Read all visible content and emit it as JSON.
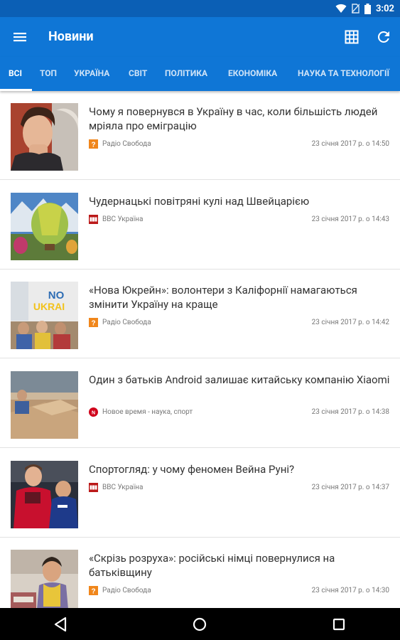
{
  "status": {
    "time": "3:02"
  },
  "app": {
    "title": "Новини"
  },
  "tabs": [
    "ВСІ",
    "ТОП",
    "УКРАЇНА",
    "СВІТ",
    "ПОЛІТИКА",
    "ЕКОНОМІКА",
    "НАУКА ТА ТЕХНОЛОГІЇ"
  ],
  "articles": [
    {
      "title": "Чому я повернувся в Україну в час, коли більшість людей мріяла про еміграцію",
      "source": "Радіо Свобода",
      "date": "23 січня 2017 р. о 14:50"
    },
    {
      "title": "Чудернацькі повітряні кулі над Швейцарією",
      "source": "BBC Україна",
      "date": "23 січня 2017 р. о 14:43"
    },
    {
      "title": "«Нова Юкрейн»: волонтери з Каліфорнії намагаються змінити Україну на краще",
      "source": "Радіо Свобода",
      "date": "23 січня 2017 р. о 14:42"
    },
    {
      "title": "Один з батьків Android залишає китайську компанію Xiaomi",
      "source": "Новое время - наука, спорт",
      "date": "23 січня 2017 р. о 14:38"
    },
    {
      "title": "Спортогляд: у чому феномен Вейна Руні?",
      "source": "BBC Україна",
      "date": "23 січня 2017 р. о 14:37"
    },
    {
      "title": "«Скрізь розруха»: російські німці повернулися на батьківщину",
      "source": "Радіо Свобода",
      "date": "23 січня 2017 р. о 14:30"
    }
  ],
  "thumb_text": {
    "nova_top": "NO",
    "nova_bottom": "UKRAI"
  },
  "colors": {
    "statusbar": "#0b5fb5",
    "appbar": "#0f76d6",
    "radio_svoboda": "#f0861b",
    "bbc": "#bb1919",
    "nv": "#d0021b"
  },
  "icons": {
    "menu": "menu-icon",
    "grid": "grid-icon",
    "refresh": "refresh-icon",
    "back": "back-icon",
    "home": "home-icon",
    "recents": "recents-icon"
  }
}
